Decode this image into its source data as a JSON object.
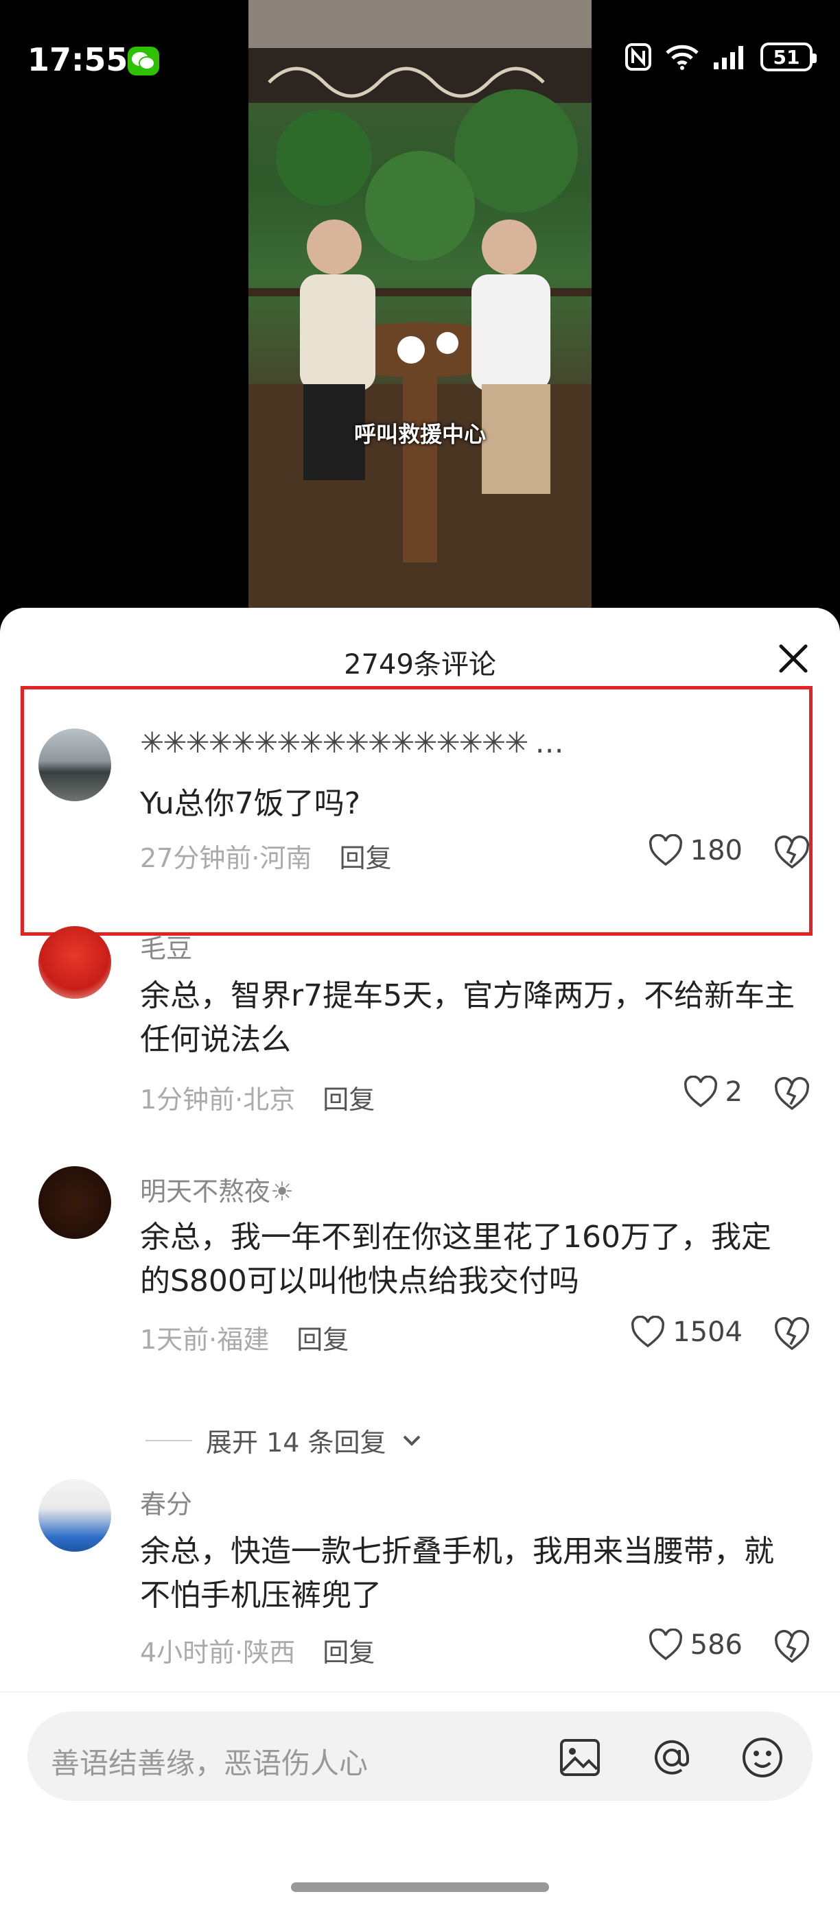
{
  "status_bar": {
    "time": "17:55",
    "battery": "51"
  },
  "video": {
    "caption": "呼叫救援中心"
  },
  "sheet": {
    "title": "2749条评论"
  },
  "comments": [
    {
      "name": "",
      "text": "Yu总你7饭了吗?",
      "meta": "27分钟前·河南",
      "reply": "回复",
      "likes": "180"
    },
    {
      "name": "毛豆",
      "text": "余总，智界r7提车5天，官方降两万，不给新车主任何说法么",
      "meta": "1分钟前·北京",
      "reply": "回复",
      "likes": "2"
    },
    {
      "name": "明天不熬夜☀",
      "text": "余总，我一年不到在你这里花了160万了，我定的S800可以叫他快点给我交付吗",
      "meta": "1天前·福建",
      "reply": "回复",
      "likes": "1504"
    },
    {
      "name": "春分",
      "text": "余总，快造一款七折叠手机，我用来当腰带，就不怕手机压裤兜了",
      "meta": "4小时前·陕西",
      "reply": "回复",
      "likes": "586"
    }
  ],
  "expand_replies": "展开 14 条回复",
  "input": {
    "placeholder": "善语结善缘，恶语伤人心"
  },
  "colors": {
    "highlight": "#e32323",
    "wechat": "#2dc100"
  }
}
